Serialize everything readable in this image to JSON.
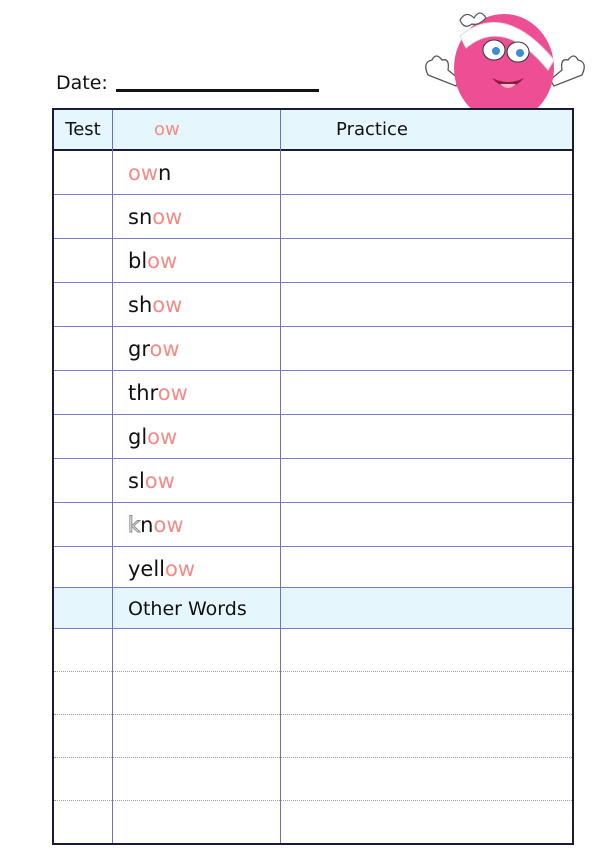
{
  "date_label": "Date:",
  "header": {
    "test": "Test",
    "spelling": "ow",
    "practice": "Practice"
  },
  "words": [
    {
      "pre": "",
      "silent": "",
      "hl": "ow",
      "post": "n"
    },
    {
      "pre": "sn",
      "silent": "",
      "hl": "ow",
      "post": ""
    },
    {
      "pre": "bl",
      "silent": "",
      "hl": "ow",
      "post": ""
    },
    {
      "pre": "sh",
      "silent": "",
      "hl": "ow",
      "post": ""
    },
    {
      "pre": "gr",
      "silent": "",
      "hl": "ow",
      "post": ""
    },
    {
      "pre": "thr",
      "silent": "",
      "hl": "ow",
      "post": ""
    },
    {
      "pre": "gl",
      "silent": "",
      "hl": "ow",
      "post": ""
    },
    {
      "pre": "sl",
      "silent": "",
      "hl": "ow",
      "post": ""
    },
    {
      "pre": "",
      "silent": "k",
      "hl": "",
      "post": "n",
      "hl2": "ow"
    },
    {
      "pre": "yell",
      "silent": "",
      "hl": "ow",
      "post": ""
    }
  ],
  "other_words_label": "Other Words",
  "colors": {
    "highlight": "#f48b86",
    "header_bg": "#e6f6fd",
    "rule": "#7b7bd0",
    "mascot": "#ee4f94"
  },
  "icons": {
    "mascot": "pink-blob-character-icon"
  }
}
